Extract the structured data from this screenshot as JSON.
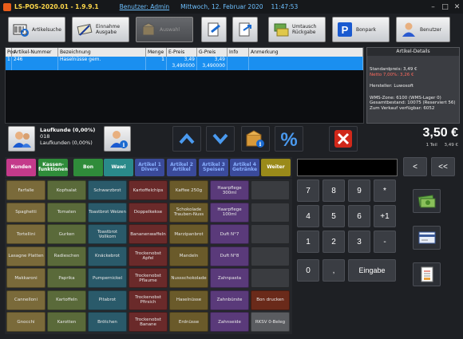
{
  "title": {
    "app": "LS-POS-2020.01 - 1.9.9.1",
    "user": "Benutzer: Admin",
    "date": "Mittwoch, 12. Februar 2020",
    "time": "11:47:53"
  },
  "toolbar": [
    {
      "label": "Artikelsuche",
      "icon": "barcode-scanner-icon"
    },
    {
      "label": "Einnahme Ausgabe",
      "icon": "cash-notes-icon"
    },
    {
      "label": "Auswahl",
      "icon": "box-icon"
    },
    {
      "label": "",
      "icon": "doc-edit-icon"
    },
    {
      "label": "",
      "icon": "doc-arrow-icon"
    },
    {
      "label": "Umtausch Rückgabe",
      "icon": "exchange-icon"
    },
    {
      "label": "Bonpark",
      "icon": "parking-icon"
    },
    {
      "label": "Benutzer",
      "icon": "user-icon"
    }
  ],
  "grid": {
    "headers": [
      "Pos",
      "Artikel-Nummer",
      "Bezeichnung",
      "Menge",
      "E-Preis",
      "G-Preis",
      "Info",
      "Anmerkung"
    ],
    "rows": [
      {
        "pos": "1",
        "nr": "246",
        "bez": "Haselnüsse gem.",
        "menge": "1",
        "epreis": "3,49",
        "epreis2": "3,490000",
        "gpreis": "3,49",
        "gpreis2": "3,490000",
        "info": "",
        "anm": ""
      }
    ]
  },
  "details": {
    "title": "Artikel-Details",
    "standardpreis": "Standardpreis: 3,49 €",
    "netto": "Netto 7,00%: 3,26 €",
    "hersteller": "Hersteller: Luwosoft",
    "wms": "WMS-Zone: 6100 (WMS-Lager 0)",
    "bestand": "Gesamtbestand: 10075 (Reserviert 56)",
    "verfuegbar": "Zum Verkauf verfügbar: 6052"
  },
  "customer": {
    "line1": "Laufkunde (0,00%)",
    "line2": "018",
    "line3": "Laufkunden (0,00%)"
  },
  "total": {
    "price": "3,50 €",
    "count": "1 Teil",
    "sub": "3,49 €"
  },
  "categories": [
    {
      "label": "Kunden",
      "bg": "#c43a8a",
      "fg": "#ffffff"
    },
    {
      "label": "Kassen-funktionen",
      "bg": "#2f8c3a",
      "fg": "#ffffff"
    },
    {
      "label": "Bon",
      "bg": "#2f8c3a",
      "fg": "#ffffff"
    },
    {
      "label": "Wawi",
      "bg": "#2a8a8a",
      "fg": "#ffffff"
    },
    {
      "label": "Artikel 1 Divers",
      "bg": "#3a4a9a",
      "fg": "#8ab0ff"
    },
    {
      "label": "Artikel 2 Artikel",
      "bg": "#3a4a9a",
      "fg": "#8ab0ff"
    },
    {
      "label": "Artikel 3 Speisen",
      "bg": "#3a4a9a",
      "fg": "#8ab0ff"
    },
    {
      "label": "Artikel 4 Getränke",
      "bg": "#3a4a9a",
      "fg": "#8ab0ff"
    },
    {
      "label": "Weiter",
      "bg": "#9a8a1a",
      "fg": "#ffffff"
    }
  ],
  "products": [
    [
      {
        "l": "Farfalle",
        "bg": "#7a6a3a"
      },
      {
        "l": "Kopfsalat",
        "bg": "#5a6a3a"
      },
      {
        "l": "Schwarzbrot",
        "bg": "#2a5a6a"
      },
      {
        "l": "Kartoffelchips",
        "bg": "#6a2a2a"
      },
      {
        "l": "Kaffee 250g",
        "bg": "#6a5a2a"
      },
      {
        "l": "Haarpflege 300ml",
        "bg": "#5a3a7a"
      },
      {
        "l": "",
        "bg": "#3a3c40"
      }
    ],
    [
      {
        "l": "Spaghetti",
        "bg": "#7a6a3a"
      },
      {
        "l": "Tomaten",
        "bg": "#5a6a3a"
      },
      {
        "l": "Toastbrot Weizen",
        "bg": "#2a5a6a"
      },
      {
        "l": "Doppelkekse",
        "bg": "#6a2a2a"
      },
      {
        "l": "Schokolade Trauben-Nuss",
        "bg": "#6a5a2a"
      },
      {
        "l": "Haarpflege 100ml",
        "bg": "#5a3a7a"
      },
      {
        "l": "",
        "bg": "#3a3c40"
      }
    ],
    [
      {
        "l": "Tortellini",
        "bg": "#7a6a3a"
      },
      {
        "l": "Gurken",
        "bg": "#5a6a3a"
      },
      {
        "l": "Toastbrot Vollkorn",
        "bg": "#2a5a6a"
      },
      {
        "l": "Bananenwaffeln",
        "bg": "#6a2a2a"
      },
      {
        "l": "Marzipanbrot",
        "bg": "#6a5a2a"
      },
      {
        "l": "Duft N°7",
        "bg": "#5a3a7a"
      },
      {
        "l": "",
        "bg": "#3a3c40"
      }
    ],
    [
      {
        "l": "Lasagne Platten",
        "bg": "#7a6a3a"
      },
      {
        "l": "Radieschen",
        "bg": "#5a6a3a"
      },
      {
        "l": "Knäckebrot",
        "bg": "#2a5a6a"
      },
      {
        "l": "Trockenobst Apfel",
        "bg": "#6a2a2a"
      },
      {
        "l": "Mandeln",
        "bg": "#6a5a2a"
      },
      {
        "l": "Duft N°8",
        "bg": "#5a3a7a"
      },
      {
        "l": "",
        "bg": "#3a3c40"
      }
    ],
    [
      {
        "l": "Makkaroni",
        "bg": "#7a6a3a"
      },
      {
        "l": "Paprika",
        "bg": "#5a6a3a"
      },
      {
        "l": "Pumpernickel",
        "bg": "#2a5a6a"
      },
      {
        "l": "Trockenobst Pflaume",
        "bg": "#6a2a2a"
      },
      {
        "l": "Nussschokolade",
        "bg": "#6a5a2a"
      },
      {
        "l": "Zahnpasta",
        "bg": "#5a3a7a"
      },
      {
        "l": "",
        "bg": "#3a3c40"
      }
    ],
    [
      {
        "l": "Cannelloni",
        "bg": "#7a6a3a"
      },
      {
        "l": "Kartoffeln",
        "bg": "#5a6a3a"
      },
      {
        "l": "Pitabrot",
        "bg": "#2a5a6a"
      },
      {
        "l": "Trockenobst Pfirsich",
        "bg": "#6a2a2a"
      },
      {
        "l": "Haselnüsse",
        "bg": "#6a5a2a"
      },
      {
        "l": "Zahnbürste",
        "bg": "#5a3a7a"
      },
      {
        "l": "Bon drucken",
        "bg": "#6a2a1a"
      }
    ],
    [
      {
        "l": "Gnocchi",
        "bg": "#7a6a3a"
      },
      {
        "l": "Karotten",
        "bg": "#5a6a3a"
      },
      {
        "l": "Brötchen",
        "bg": "#2a5a6a"
      },
      {
        "l": "Trockenobst Banane",
        "bg": "#6a2a2a"
      },
      {
        "l": "Erdnüsse",
        "bg": "#6a5a2a"
      },
      {
        "l": "Zahnseide",
        "bg": "#5a3a7a"
      },
      {
        "l": "RKSV 0-Beleg",
        "bg": "#5a5c60"
      }
    ]
  ],
  "keypad": {
    "back": "<",
    "clear": "<<",
    "keys": [
      "7",
      "8",
      "9",
      "*",
      "4",
      "5",
      "6",
      "+1",
      "1",
      "2",
      "3",
      "-",
      "0",
      ",",
      "Eingabe"
    ]
  }
}
